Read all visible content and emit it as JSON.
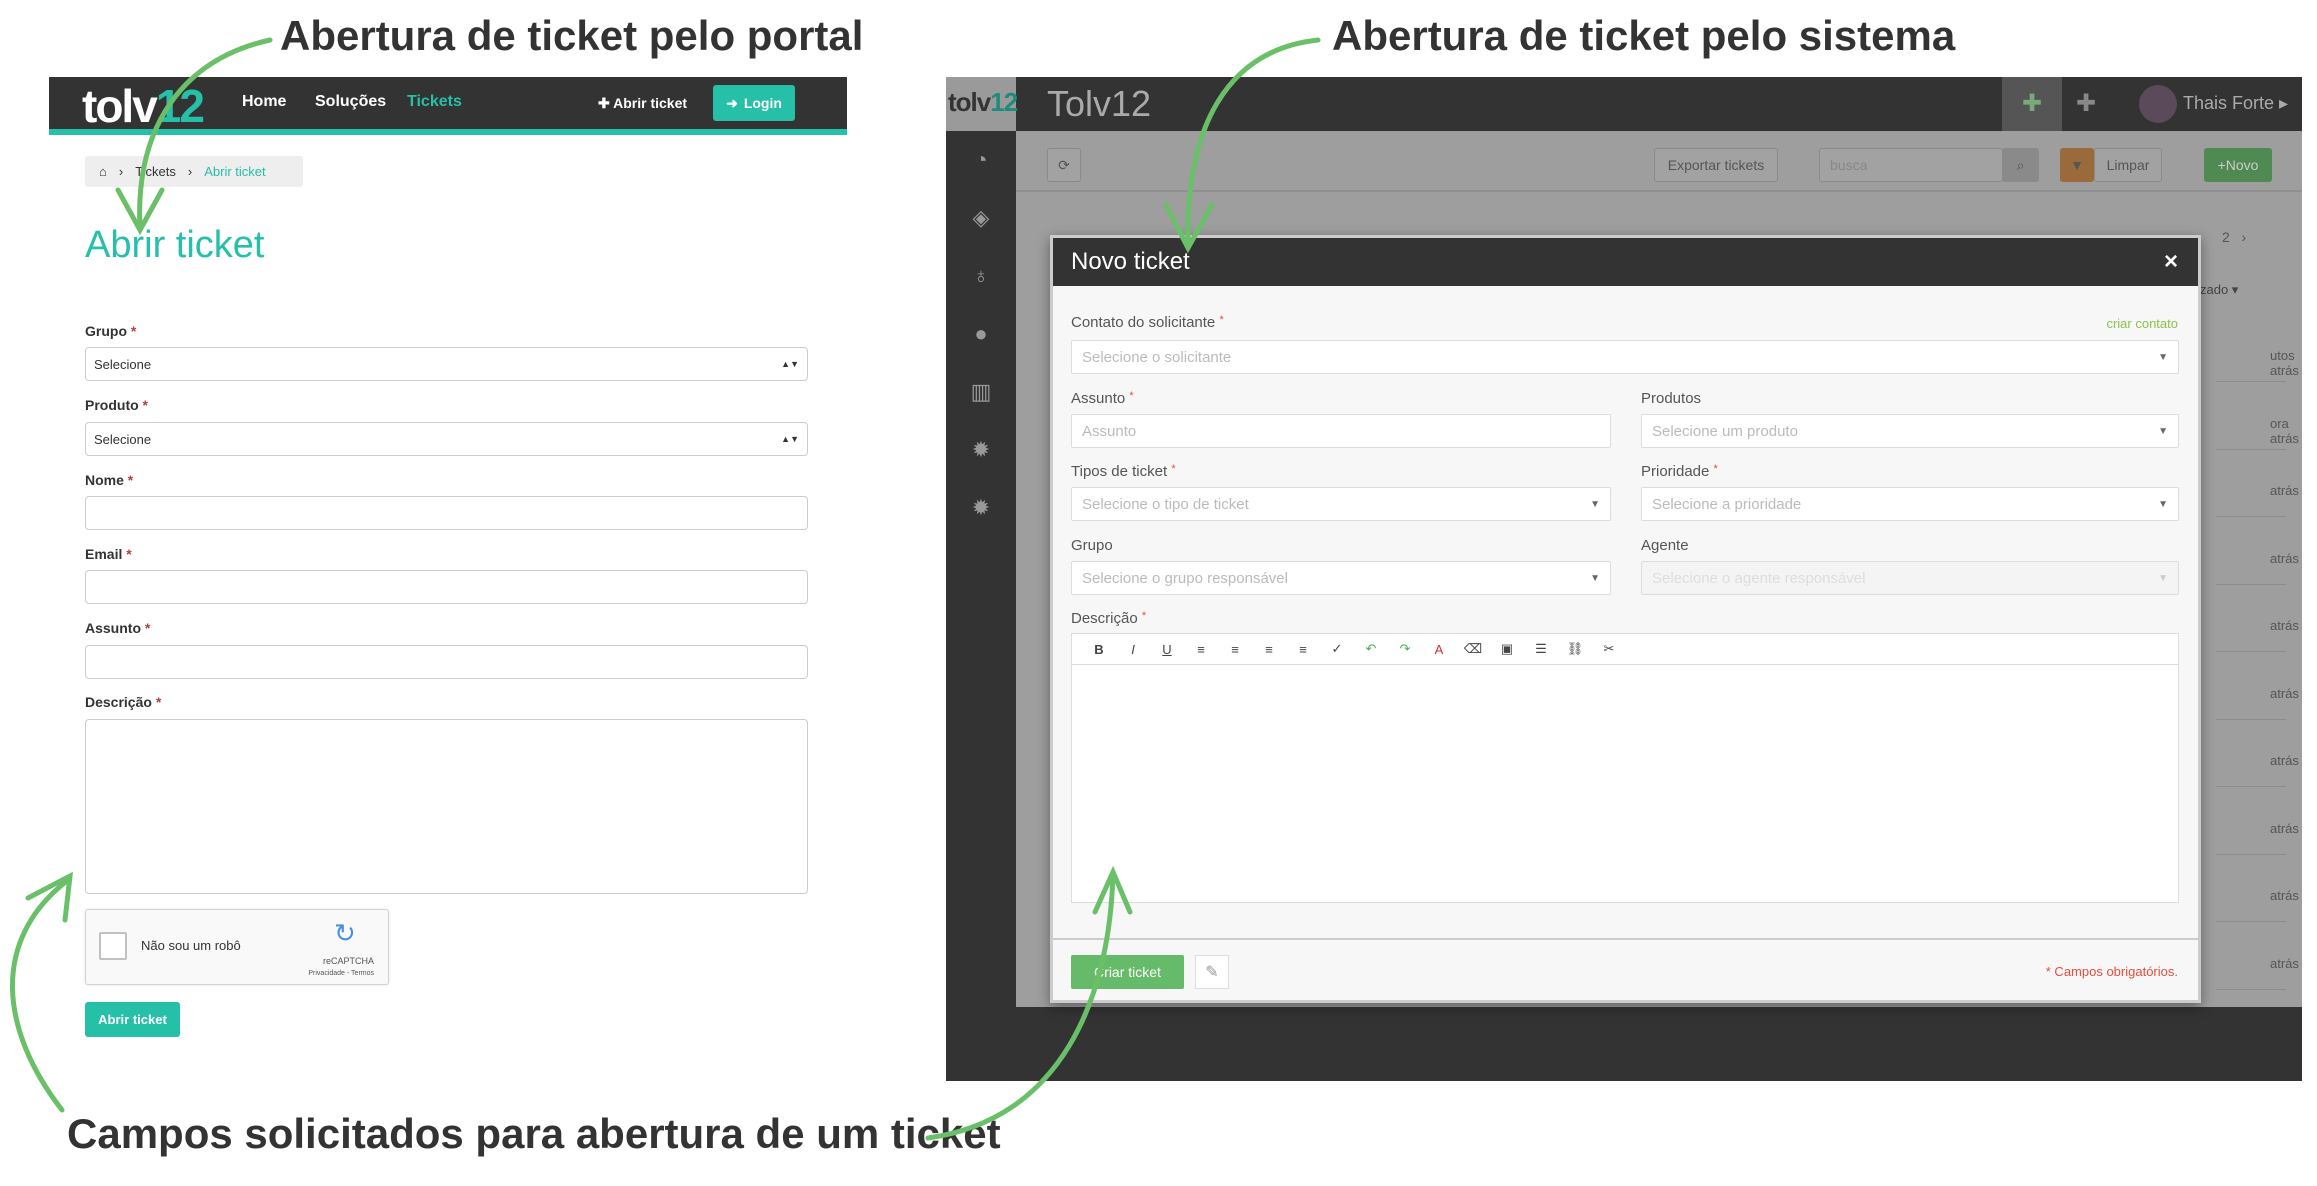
{
  "captions": {
    "portal": "Abertura de ticket pelo portal",
    "system": "Abertura de ticket pelo sistema",
    "fields": "Campos solicitados para abertura de um ticket"
  },
  "colors": {
    "accent": "#26bfa8",
    "arrow": "#6abf69",
    "dark": "#333333",
    "green": "#66bb6a",
    "orange": "#c97a2c",
    "required": "#e74c3c"
  },
  "portal": {
    "logo": "tolv12",
    "nav": [
      "Home",
      "Soluções",
      "Tickets"
    ],
    "active_nav": "Tickets",
    "open_ticket": "Abrir ticket",
    "login": "Login",
    "breadcrumb": [
      "Tickets",
      "Abrir ticket"
    ],
    "heading": "Abrir ticket",
    "fields": [
      {
        "label": "Grupo",
        "type": "select",
        "value": "Selecione"
      },
      {
        "label": "Produto",
        "type": "select",
        "value": "Selecione"
      },
      {
        "label": "Nome",
        "type": "text",
        "value": ""
      },
      {
        "label": "Email",
        "type": "text",
        "value": ""
      },
      {
        "label": "Assunto",
        "type": "text",
        "value": ""
      },
      {
        "label": "Descrição",
        "type": "textarea",
        "value": ""
      }
    ],
    "required_mark": "*",
    "captcha": {
      "label": "Não sou um robô",
      "brand": "reCAPTCHA",
      "links": "Privacidade - Termos"
    },
    "submit": "Abrir ticket"
  },
  "system": {
    "logo": "tolv12",
    "title": "Tolv12",
    "user": "Thais Forte",
    "sidebar": [
      "dashboard-icon",
      "ticket-icon",
      "lightbulb-icon",
      "user-icon",
      "chart-icon",
      "gear-icon",
      "gears-icon"
    ],
    "toolbar": {
      "export": "Exportar tickets",
      "search_placeholder": "busca",
      "clear": "Limpar",
      "new": "+Novo"
    },
    "pagination": [
      "2",
      "›"
    ],
    "sort_col": "zado ▾",
    "rows": [
      "utos atrás",
      "ora atrás",
      "atrás",
      "atrás",
      "atrás",
      "atrás",
      "atrás",
      "atrás",
      "atrás",
      "atrás"
    ],
    "modal": {
      "title": "Novo ticket",
      "close": "×",
      "contact_label": "Contato do solicitante",
      "create_contact": "criar contato",
      "contact_placeholder": "Selecione o solicitante",
      "subject_label": "Assunto",
      "subject_placeholder": "Assunto",
      "products_label": "Produtos",
      "products_placeholder": "Selecione um produto",
      "type_label": "Tipos de ticket",
      "type_placeholder": "Selecione o tipo de ticket",
      "priority_label": "Prioridade",
      "priority_placeholder": "Selecione a prioridade",
      "group_label": "Grupo",
      "group_placeholder": "Selecione o grupo responsável",
      "agent_label": "Agente",
      "agent_placeholder": "Selecione o agente responsável",
      "desc_label": "Descrição",
      "editor_tools": [
        "B",
        "I",
        "U",
        "≡",
        "≡",
        "≡",
        "≡",
        "✓",
        "↶",
        "↷",
        "A",
        "⌫",
        "▣",
        "☰",
        "⛓",
        "✂"
      ],
      "submit": "Criar ticket",
      "required_note": "* Campos obrigatórios."
    }
  }
}
